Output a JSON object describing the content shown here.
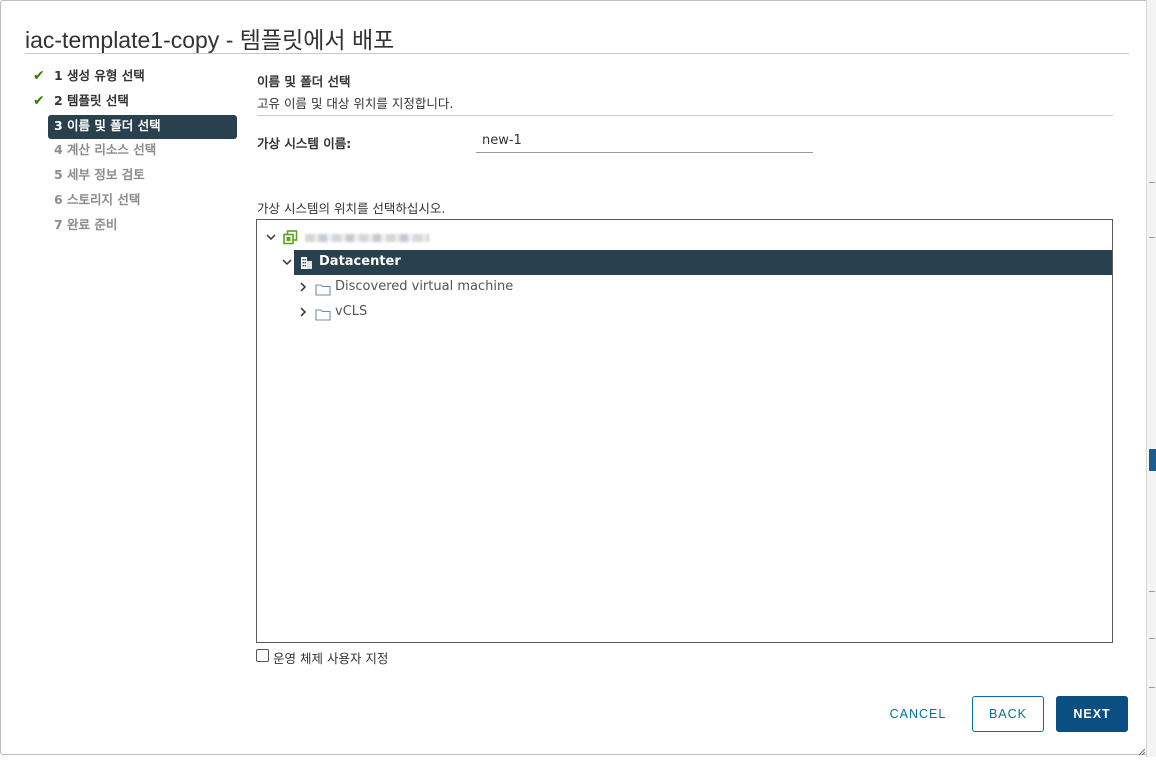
{
  "dialog": {
    "title": "iac-template1-copy - 템플릿에서 배포"
  },
  "steps": [
    {
      "label": "1 생성 유형 선택",
      "state": "done"
    },
    {
      "label": "2 템플릿 선택",
      "state": "done"
    },
    {
      "label": "3 이름 및 폴더 선택",
      "state": "active"
    },
    {
      "label": "4 계산 리소스 선택",
      "state": "pending"
    },
    {
      "label": "5 세부 정보 검토",
      "state": "pending"
    },
    {
      "label": "6 스토리지 선택",
      "state": "pending"
    },
    {
      "label": "7 완료 준비",
      "state": "pending"
    }
  ],
  "section": {
    "title": "이름 및 폴더 선택",
    "subtitle": "고유 이름 및 대상 위치를 지정합니다."
  },
  "vm_name": {
    "label": "가상 시스템 이름:",
    "value": "new-1"
  },
  "location": {
    "label": "가상 시스템의 위치를 선택하십시오."
  },
  "tree": {
    "root": {
      "label": "",
      "icon": "vcenter-icon",
      "expanded": true,
      "blurred": true
    },
    "datacenter": {
      "label": "Datacenter",
      "icon": "datacenter-icon",
      "expanded": true,
      "selected": true
    },
    "folders": [
      {
        "label": "Discovered virtual machine",
        "icon": "folder-icon"
      },
      {
        "label": "vCLS",
        "icon": "folder-icon"
      }
    ]
  },
  "os_customize": {
    "label": "운영 체제 사용자 지정",
    "checked": false
  },
  "buttons": {
    "cancel": "CANCEL",
    "back": "BACK",
    "next": "NEXT"
  },
  "colors": {
    "selected_bg": "#29414e",
    "primary": "#0b4f82",
    "link": "#0072a3",
    "check_green": "#2f8400",
    "vcenter_green": "#5aa220"
  }
}
